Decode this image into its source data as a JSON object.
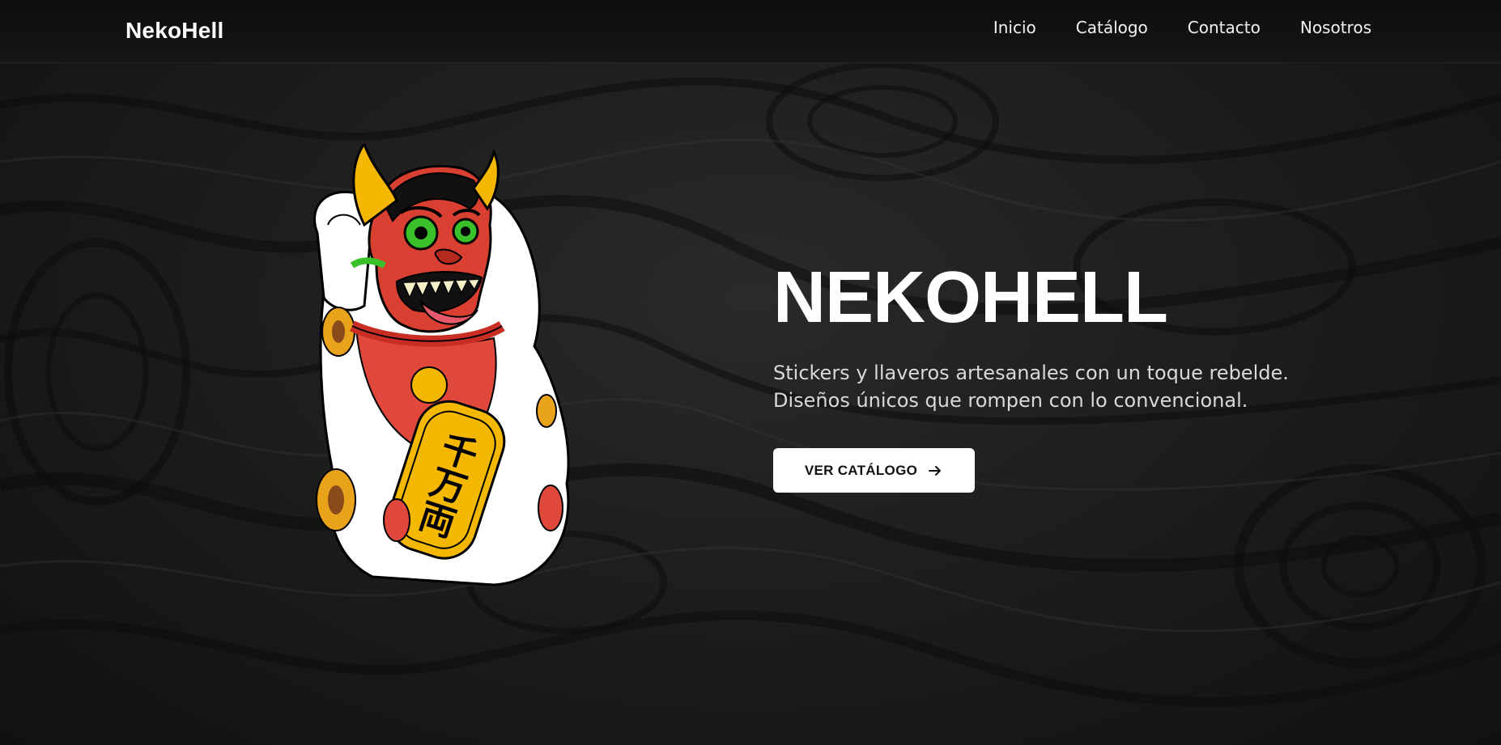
{
  "brand": {
    "name": "NekoHell"
  },
  "nav": {
    "items": [
      {
        "label": "Inicio"
      },
      {
        "label": "Catálogo"
      },
      {
        "label": "Contacto"
      },
      {
        "label": "Nosotros"
      }
    ]
  },
  "hero": {
    "title": "NEKOHELL",
    "subtitle_line1": "Stickers y llaveros artesanales con un toque rebelde.",
    "subtitle_line2": "Diseños únicos que rompen con lo convencional.",
    "cta_label": "VER CATÁLOGO",
    "cta_icon": "arrow-right-icon",
    "mascot_icon": "oni-lucky-cat-illustration",
    "mascot_kanji": "千万両"
  },
  "colors": {
    "background": "#1e1e1e",
    "header": "#111111",
    "text": "#ffffff",
    "button_bg": "#ffffff",
    "button_text": "#111111",
    "mascot_red": "#e0483c",
    "mascot_gold": "#f5b800",
    "mascot_green": "#39c12a"
  }
}
